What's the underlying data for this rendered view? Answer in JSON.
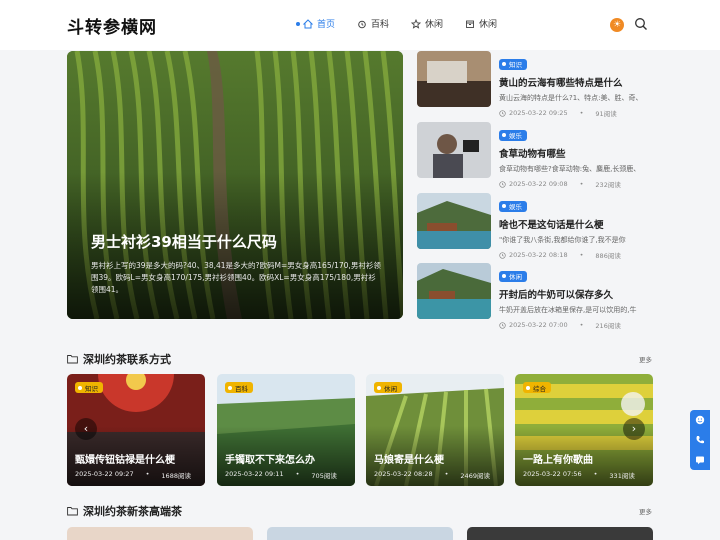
{
  "site": {
    "logo": "斗转参横网"
  },
  "nav": [
    {
      "label": "首页",
      "active": true,
      "icon": "home-icon"
    },
    {
      "label": "百科",
      "active": false,
      "icon": "alarm-icon"
    },
    {
      "label": "休闲",
      "active": false,
      "icon": "star-icon"
    },
    {
      "label": "休闲",
      "active": false,
      "icon": "box-icon"
    }
  ],
  "header": {
    "theme_icon": "sun-icon",
    "search_icon": "search-icon"
  },
  "hero": {
    "title": "男士衬衫39相当于什么尺码",
    "desc": "男衬衫上写的39是多大的码?40、38,41是多大的?欧码M=男女身高165/170,男衬衫领围39。欧码L=男女身高170/175,男衬衫领围40。欧码XL=男女身高175/180,男衬衫领围41。"
  },
  "side": [
    {
      "tag": "知识",
      "title": "黄山的云海有哪些特点是什么",
      "desc": "黄山云海的特点是什么?1、特点:美、胜、奇、",
      "date": "2025-03-22 09:25",
      "views": "91阅读"
    },
    {
      "tag": "娱乐",
      "title": "食草动物有哪些",
      "desc": "食草动物有哪些?食草动物:兔、麋鹿,长颈鹿、",
      "date": "2025-03-22 09:08",
      "views": "232阅读"
    },
    {
      "tag": "娱乐",
      "title": "啥也不是这句话是什么梗",
      "desc": "\"你谁了我八条街,我都给你谁了,我不是你",
      "date": "2025-03-22 08:18",
      "views": "886阅读"
    },
    {
      "tag": "休闲",
      "title": "开封后的牛奶可以保存多久",
      "desc": "牛奶开盖后放在冰箱里保存,是可以饮用的,牛",
      "date": "2025-03-22 07:00",
      "views": "216阅读"
    }
  ],
  "section1": {
    "title": "深圳约茶联系方式",
    "more": "更多"
  },
  "cards": [
    {
      "tag": "知识",
      "title": "甄嬛传钮钴禄是什么梗",
      "date": "2025-03-22 09:27",
      "views": "1688阅读"
    },
    {
      "tag": "百科",
      "title": "手镯取不下来怎么办",
      "date": "2025-03-22 09:11",
      "views": "705阅读"
    },
    {
      "tag": "休闲",
      "title": "马娘寄是什么梗",
      "date": "2025-03-22 08:28",
      "views": "2469阅读"
    },
    {
      "tag": "综合",
      "title": "一路上有你歌曲",
      "date": "2025-03-22 07:56",
      "views": "331阅读"
    }
  ],
  "section2": {
    "title": "深圳约茶新茶高端茶",
    "more": "更多"
  },
  "colors": {
    "accent": "#2b7de9",
    "tag_yellow": "#f0b400",
    "theme_orange": "#f08a24"
  }
}
